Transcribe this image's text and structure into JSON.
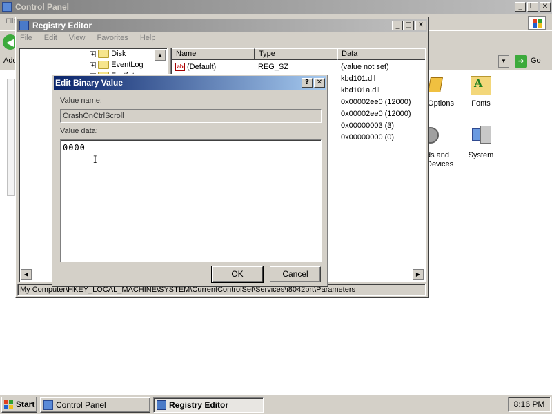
{
  "control_panel": {
    "title": "Control Panel",
    "menu_file": "File",
    "address_label": "Address",
    "go_label": "Go",
    "icons": [
      {
        "name": "Options",
        "icon": "options-icon"
      },
      {
        "name": "Fonts",
        "icon": "fonts-icon"
      },
      {
        "name": "ds and Devices",
        "icon": "devices-icon"
      },
      {
        "name": "System",
        "icon": "system-icon"
      }
    ]
  },
  "registry_editor": {
    "title": "Registry Editor",
    "menu": [
      "File",
      "Edit",
      "View",
      "Favorites",
      "Help"
    ],
    "tree": [
      {
        "label": "Disk"
      },
      {
        "label": "EventLog"
      },
      {
        "label": "Fastfat"
      }
    ],
    "columns": [
      "Name",
      "Type",
      "Data"
    ],
    "rows": [
      {
        "name": "(Default)",
        "type": "REG_SZ",
        "data": "(value not set)"
      },
      {
        "name": "",
        "type": "",
        "data": "kbd101.dll"
      },
      {
        "name": "",
        "type": "",
        "data": "kbd101a.dll"
      },
      {
        "name": "",
        "type": "",
        "data": "0x00002ee0 (12000)"
      },
      {
        "name": "",
        "type": "",
        "data": "0x00002ee0 (12000)"
      },
      {
        "name": "",
        "type": "",
        "data": "0x00000003 (3)"
      },
      {
        "name": "",
        "type": "",
        "data": "0x00000000 (0)"
      }
    ],
    "status": "My Computer\\HKEY_LOCAL_MACHINE\\SYSTEM\\CurrentControlSet\\Services\\i8042prt\\Parameters"
  },
  "dialog": {
    "title": "Edit Binary Value",
    "help_label": "?",
    "close_label": "✕",
    "value_name_label": "Value name:",
    "value_name": "CrashOnCtrlScroll",
    "value_data_label": "Value data:",
    "value_data": "0000",
    "ok_label": "OK",
    "cancel_label": "Cancel"
  },
  "taskbar": {
    "start_label": "Start",
    "tasks": [
      {
        "label": "Control Panel",
        "active": false
      },
      {
        "label": "Registry Editor",
        "active": true
      }
    ],
    "clock": "8:16 PM"
  },
  "colors": {
    "active_title": "#0a246a",
    "inactive_title": "#808080",
    "face": "#d4d0c8"
  }
}
